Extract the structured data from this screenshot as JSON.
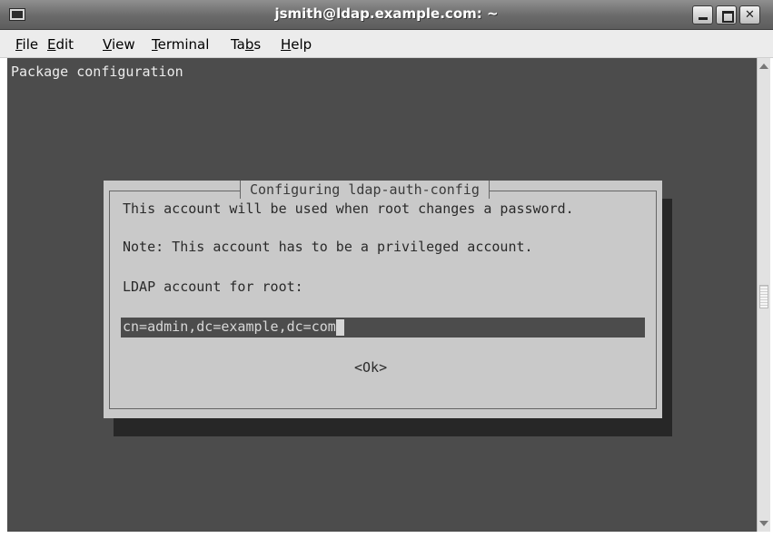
{
  "window": {
    "title": "jsmith@ldap.example.com: ~",
    "app_icon": "terminal-icon",
    "controls": [
      {
        "name": "minimize-icon"
      },
      {
        "name": "maximize-icon"
      },
      {
        "name": "close-icon",
        "glyph": "✕"
      }
    ]
  },
  "menu": [
    {
      "mnemonic": "F",
      "rest": "ile"
    },
    {
      "mnemonic": "E",
      "rest": "dit"
    },
    {
      "mnemonic": "V",
      "rest": "iew"
    },
    {
      "mnemonic": "T",
      "rest": "erminal"
    },
    {
      "pre": "Ta",
      "mnemonic": "b",
      "rest": "s"
    },
    {
      "mnemonic": "H",
      "rest": "elp"
    }
  ],
  "terminal": {
    "header": "Package configuration",
    "dialog": {
      "title": "Configuring ldap-auth-config",
      "lines": [
        "This account will be used when root changes a password.",
        "Note: This account has to be a privileged account.",
        "LDAP account for root:"
      ],
      "input_value": "cn=admin,dc=example,dc=com",
      "ok_label": "<Ok>"
    }
  },
  "colors": {
    "terminal_bg": "#4c4c4c",
    "dialog_bg": "#c9c9c9",
    "shadow": "#272727"
  }
}
